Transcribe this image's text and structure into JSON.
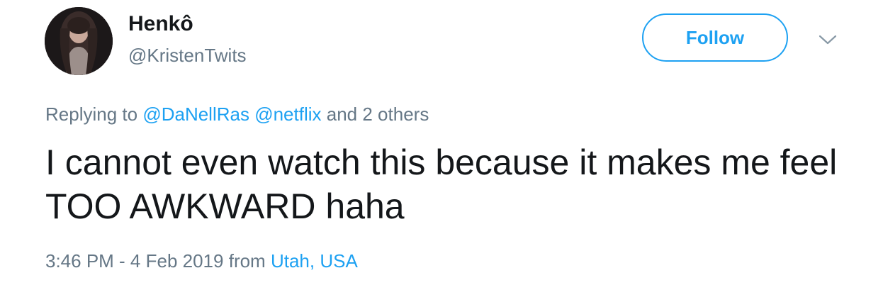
{
  "user": {
    "display_name": "Henkô",
    "handle": "@KristenTwits"
  },
  "follow": {
    "label": "Follow"
  },
  "menu": {
    "icon": "chevron-down-icon"
  },
  "reply": {
    "prefix": "Replying to",
    "mentions": [
      "@DaNellRas",
      "@netflix"
    ],
    "suffix": "and 2 others"
  },
  "tweet": {
    "text": "I cannot even watch this because it makes me feel TOO AWKWARD haha"
  },
  "meta": {
    "timestamp": "3:46 PM - 4 Feb 2019",
    "from_label": "from",
    "location": "Utah, USA"
  },
  "colors": {
    "accent": "#1da1f2",
    "secondary_text": "#657786",
    "primary_text": "#14171a"
  }
}
